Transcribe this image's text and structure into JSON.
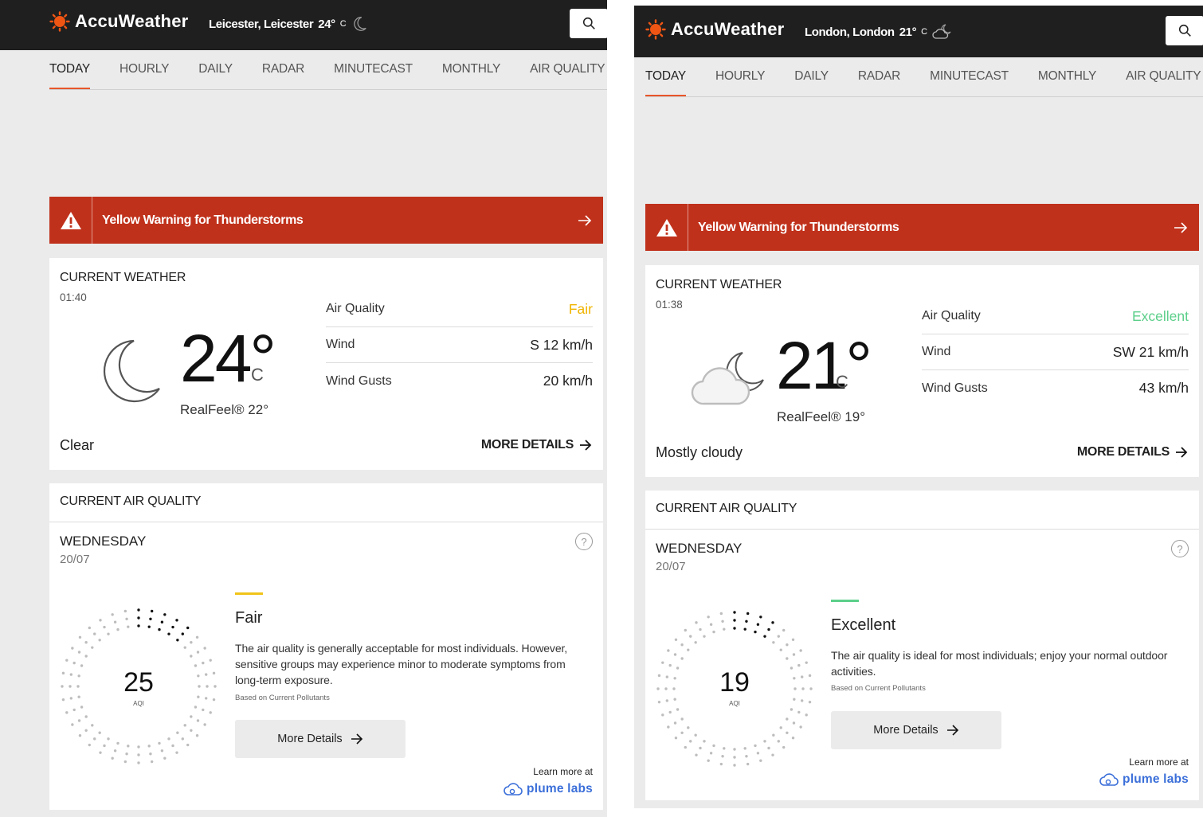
{
  "brand": {
    "name": "AccuWeather",
    "accent": "#e8562a"
  },
  "nav": {
    "tabs": [
      "TODAY",
      "HOURLY",
      "DAILY",
      "RADAR",
      "MINUTECAST",
      "MONTHLY",
      "AIR QUALITY"
    ]
  },
  "icons": {
    "search": "search-icon",
    "warning": "warning-icon",
    "arrow": "arrow-right-icon",
    "help": "question-icon",
    "plume": "plume-cloud-icon"
  },
  "panels": [
    {
      "header": {
        "location": "Leicester, Leicester",
        "temp": "24°",
        "unit": "C",
        "icon": "moon-icon"
      },
      "warning": {
        "text": "Yellow Warning for Thunderstorms",
        "color": "#c0311b"
      },
      "current": {
        "title": "CURRENT WEATHER",
        "time": "01:40",
        "temp": "24°",
        "unit": "C",
        "realfeel": "RealFeel® 22°",
        "condition": "Clear",
        "icon": "moon-icon",
        "more": "MORE DETAILS",
        "metrics": [
          {
            "label": "Air Quality",
            "value": "Fair",
            "color": "#f0b400"
          },
          {
            "label": "Wind",
            "value": "S 12 km/h"
          },
          {
            "label": "Wind Gusts",
            "value": "20 km/h"
          }
        ]
      },
      "air": {
        "title": "CURRENT AIR QUALITY",
        "day": "WEDNESDAY",
        "date": "20/07",
        "value": "25",
        "value_label": "AQI",
        "category": "Fair",
        "bar_color": "#f0c419",
        "description": "The air quality is generally acceptable for most individuals. However, sensitive groups may experience minor to moderate symptoms from long-term exposure.",
        "based_on": "Based on Current Pollutants",
        "button": "More Details",
        "learn_more": "Learn more at",
        "partner": "plume labs"
      }
    },
    {
      "header": {
        "location": "London, London",
        "temp": "21°",
        "unit": "C",
        "icon": "cloud-moon-icon"
      },
      "warning": {
        "text": "Yellow Warning for Thunderstorms",
        "color": "#c0311b"
      },
      "current": {
        "title": "CURRENT WEATHER",
        "time": "01:38",
        "temp": "21°",
        "unit": "C",
        "realfeel": "RealFeel® 19°",
        "condition": "Mostly cloudy",
        "icon": "cloud-moon-icon",
        "more": "MORE DETAILS",
        "metrics": [
          {
            "label": "Air Quality",
            "value": "Excellent",
            "color": "#5ccf8a"
          },
          {
            "label": "Wind",
            "value": "SW 21 km/h"
          },
          {
            "label": "Wind Gusts",
            "value": "43 km/h"
          }
        ]
      },
      "air": {
        "title": "CURRENT AIR QUALITY",
        "day": "WEDNESDAY",
        "date": "20/07",
        "value": "19",
        "value_label": "AQI",
        "category": "Excellent",
        "bar_color": "#5ccf8a",
        "description": "The air quality is ideal for most individuals; enjoy your normal outdoor activities.",
        "based_on": "Based on Current Pollutants",
        "button": "More Details",
        "learn_more": "Learn more at",
        "partner": "plume labs"
      }
    }
  ]
}
